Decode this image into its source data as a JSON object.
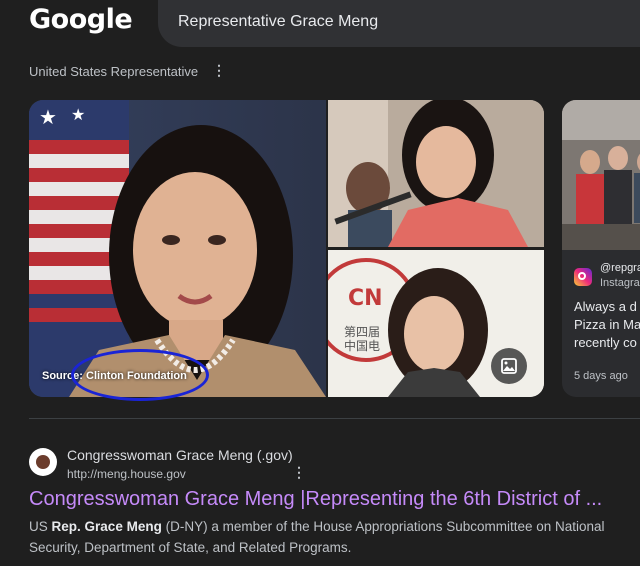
{
  "header": {
    "logo": "Google",
    "search_query": "Representative Grace Meng"
  },
  "knowledge": {
    "subtitle": "United States Representative",
    "kebab": "⋮"
  },
  "images": {
    "main_caption": "Source: Clinton Foundation",
    "annotation_color": "#1a24d6",
    "card": {
      "handle": "@repgra",
      "site": "Instagra",
      "text_lines": [
        "Always a d",
        "Pizza in Ma",
        "recently co"
      ],
      "date": "5 days ago"
    }
  },
  "result": {
    "site_name": "Congresswoman Grace Meng (.gov)",
    "url": "http://meng.house.gov",
    "kebab": "⋮",
    "title": "Congresswoman Grace Meng |Representing the 6th District of ...",
    "snippet_parts": [
      {
        "text": "US ",
        "bold": false
      },
      {
        "text": "Rep.",
        "bold": true
      },
      {
        "text": " ",
        "bold": false
      },
      {
        "text": "Grace Meng",
        "bold": true
      },
      {
        "text": " (D-NY) a member of the House Appropriations Subcommittee on National Security, Department of State, and Related Programs.",
        "bold": false
      }
    ]
  },
  "colors": {
    "background": "#1f1f1f",
    "link_visited": "#c58af9",
    "search_box": "#303134"
  }
}
